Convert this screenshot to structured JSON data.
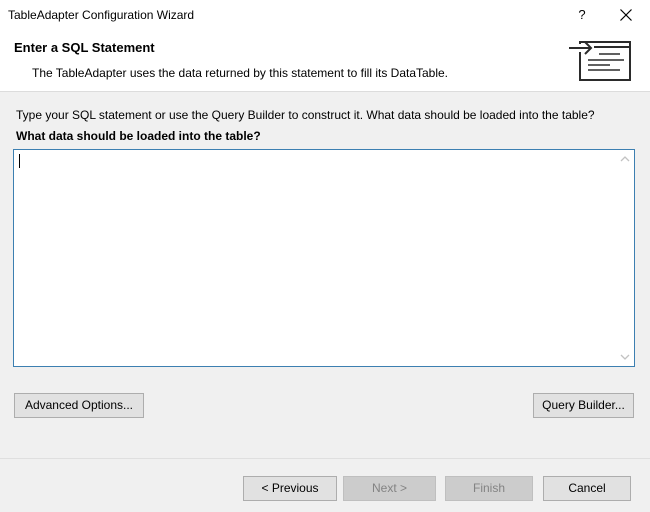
{
  "window": {
    "title": "TableAdapter Configuration Wizard",
    "help_label": "?"
  },
  "header": {
    "heading": "Enter a SQL Statement",
    "description": "The TableAdapter uses the data returned by this statement to fill its DataTable."
  },
  "content": {
    "instruction": "Type your SQL statement or use the Query Builder to construct it. What data should be loaded into the table?",
    "question": "What data should be loaded into the table?",
    "sql_value": ""
  },
  "buttons": {
    "advanced_options": "Advanced Options...",
    "query_builder": "Query Builder...",
    "previous": "< Previous",
    "next": "Next >",
    "finish": "Finish",
    "cancel": "Cancel"
  },
  "colors": {
    "accent_border": "#3c7fb1",
    "window_bg": "#f0f0f0",
    "disabled_button_bg": "#cccccc"
  },
  "icons": {
    "help": "help-icon",
    "close": "close-icon",
    "wizard": "sql-statement-icon",
    "scroll_up": "chevron-up-icon",
    "scroll_down": "chevron-down-icon"
  }
}
